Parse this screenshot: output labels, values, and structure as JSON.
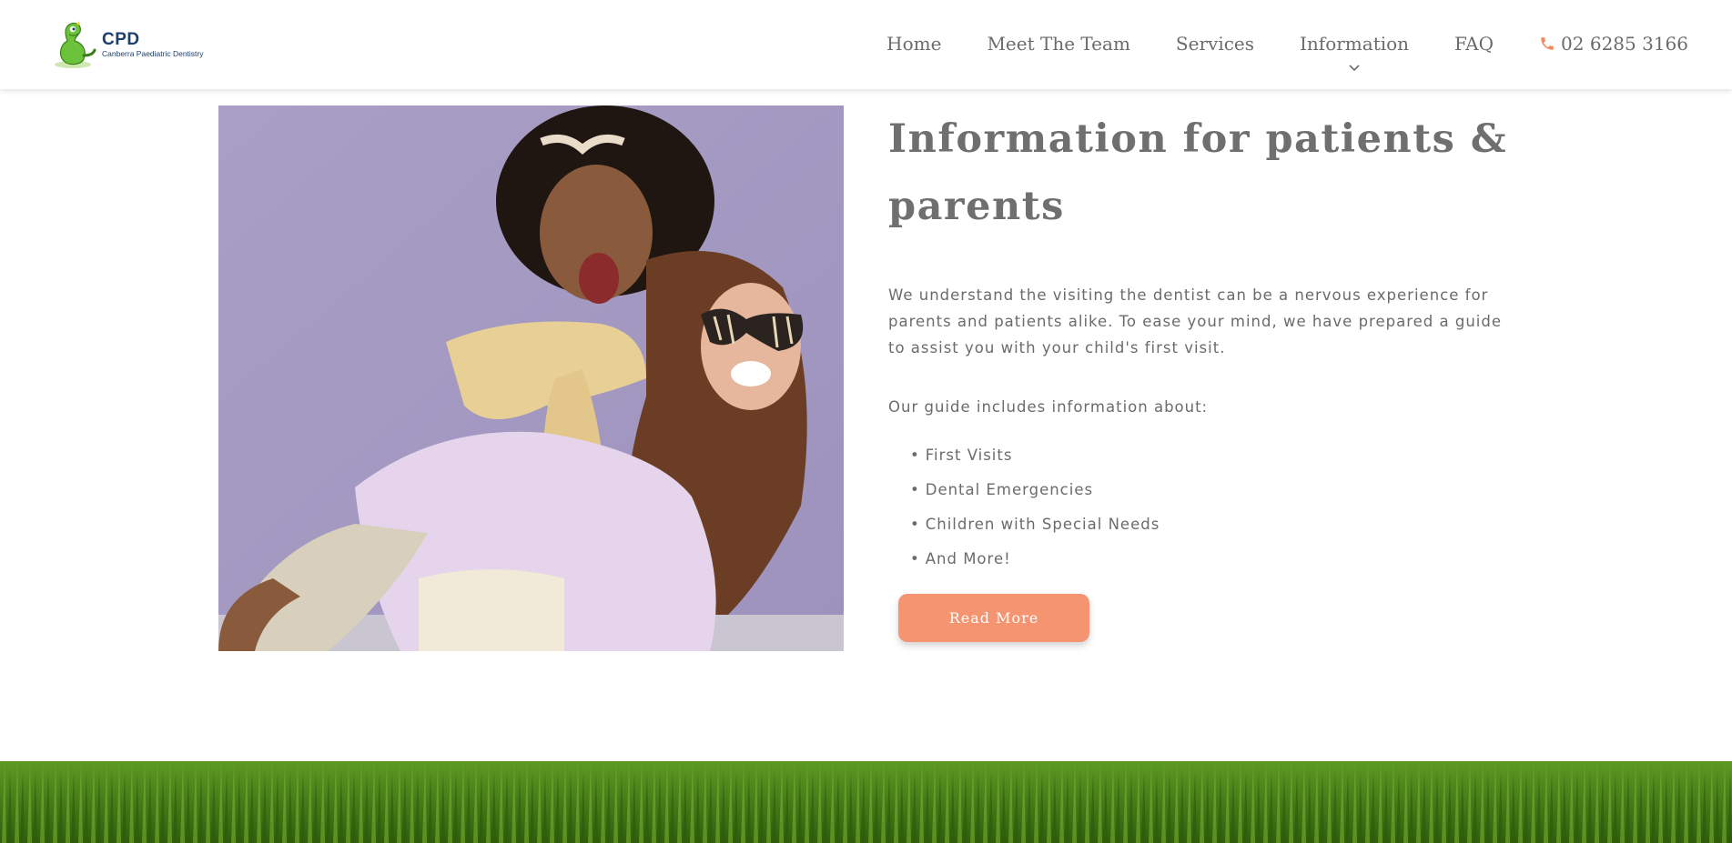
{
  "header": {
    "logo": {
      "title": "CPD",
      "subtitle": "Canberra Paediatric Dentistry"
    },
    "nav": [
      {
        "label": "Home"
      },
      {
        "label": "Meet The Team"
      },
      {
        "label": "Services"
      },
      {
        "label": "Information",
        "has_dropdown": true
      },
      {
        "label": "FAQ"
      }
    ],
    "phone": {
      "icon": "phone-icon",
      "number": "02 6285 3166"
    }
  },
  "main": {
    "image": {
      "description_icon": "photo-two-children"
    },
    "heading": "Information for patients & parents",
    "intro": "We understand the visiting the dentist can be a nervous experience for parents and patients alike. To ease your mind, we have prepared a guide to assist you with your child's first visit.",
    "guide_intro": "Our guide includes information about:",
    "guide_items": [
      "First Visits",
      "Dental Emergencies",
      "Children with Special Needs",
      "And More!"
    ],
    "read_more": "Read More"
  },
  "colors": {
    "accent": "#f49470",
    "text": "#6b6b6b",
    "logo_blue": "#1c3f6e",
    "photo_bg": "#a79cc3",
    "grass": "#3f7a12"
  }
}
